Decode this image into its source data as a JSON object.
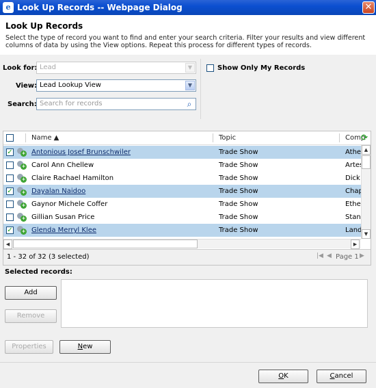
{
  "window": {
    "title": "Look Up Records -- Webpage Dialog",
    "close": "✕"
  },
  "header": {
    "title": "Look Up Records",
    "description": "Select the type of record you want to find and enter your search criteria. Filter your results and view different columns of data by using the View options. Repeat this process for different types of records."
  },
  "search": {
    "look_for_label": "Look for:",
    "look_for_value": "Lead",
    "view_label": "View:",
    "view_value": "Lead Lookup View",
    "search_label": "Search:",
    "search_placeholder": "Search for records",
    "show_only_mine": "Show Only My Records",
    "show_only_mine_checked": false
  },
  "grid": {
    "columns": [
      "Name ▲",
      "Topic",
      "Comp"
    ],
    "rows": [
      {
        "name": "Antonious Josef Brunschwiler",
        "topic": "Trade Show",
        "company": "Athe",
        "selected": true
      },
      {
        "name": "Carol Ann Chellew",
        "topic": "Trade Show",
        "company": "Artes",
        "selected": false
      },
      {
        "name": "Claire Rachael Hamilton",
        "topic": "Trade Show",
        "company": "Dick",
        "selected": false
      },
      {
        "name": "Dayalan Naidoo",
        "topic": "Trade Show",
        "company": "Chap",
        "selected": true
      },
      {
        "name": "Gaynor Michele Coffer",
        "topic": "Trade Show",
        "company": "Ethe",
        "selected": false
      },
      {
        "name": "Gillian Susan Price",
        "topic": "Trade Show",
        "company": "Stan",
        "selected": false
      },
      {
        "name": "Glenda Merryl Klee",
        "topic": "Trade Show",
        "company": "Land",
        "selected": true
      }
    ],
    "status": "1 - 32 of 32 (3 selected)",
    "page": "Page 1"
  },
  "selected": {
    "label": "Selected records:",
    "add": "Add",
    "remove": "Remove"
  },
  "footer": {
    "properties": "Properties",
    "new_label_u": "N",
    "new_label_rest": "ew",
    "ok_label_u": "O",
    "ok_label_rest": "K",
    "cancel_label_u": "C",
    "cancel_label_rest": "ancel"
  },
  "colors": {
    "titlebar": "#0b4fd0",
    "selected_row": "#b9d5ec",
    "checkmark": "#21a121"
  }
}
